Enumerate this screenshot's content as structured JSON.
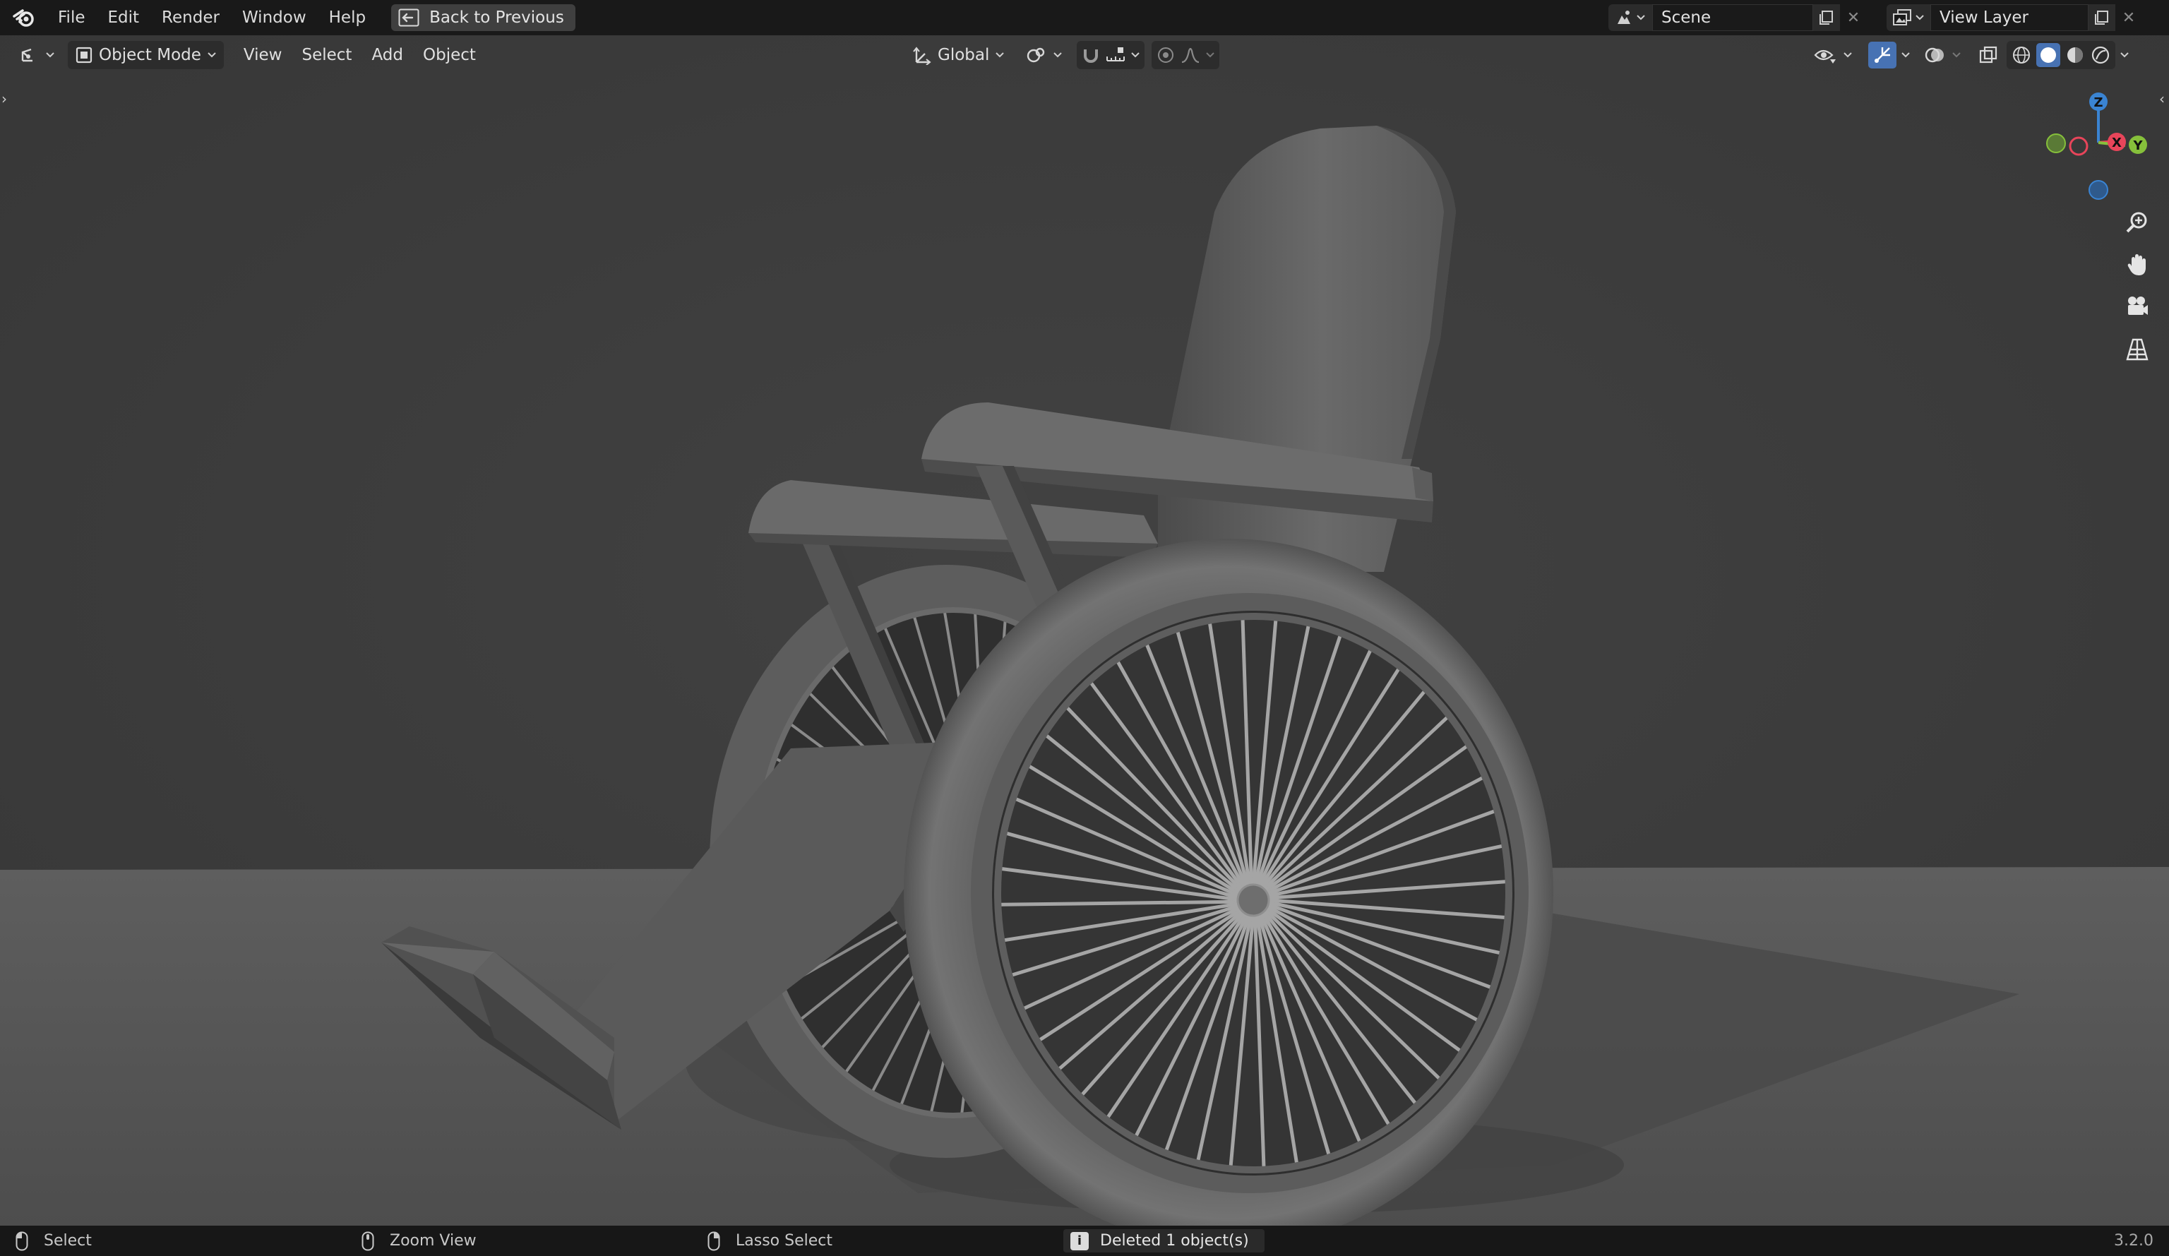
{
  "topbar": {
    "menus": [
      "File",
      "Edit",
      "Render",
      "Window",
      "Help"
    ],
    "back_button": "Back to Previous",
    "scene": {
      "name": "Scene"
    },
    "view_layer": {
      "name": "View Layer"
    }
  },
  "viewport": {
    "editor_type_icon": "3d-viewport-icon",
    "mode": "Object Mode",
    "menus": [
      "View",
      "Select",
      "Add",
      "Object"
    ],
    "transform_orientation": "Global",
    "gizmo_axes": {
      "z": "Z",
      "x": "X",
      "y": "Y"
    },
    "axis_colors": {
      "x": "#e8455a",
      "y": "#86c03b",
      "z": "#3a84d3"
    },
    "shading_mode": "solid",
    "nav_tools": [
      "zoom-icon",
      "hand-pan-icon",
      "camera-icon",
      "perspective-grid-icon"
    ]
  },
  "statusbar": {
    "left": "Select",
    "middle": "Zoom View",
    "right": "Lasso Select",
    "report": "Deleted 1 object(s)",
    "version": "3.2.0"
  }
}
